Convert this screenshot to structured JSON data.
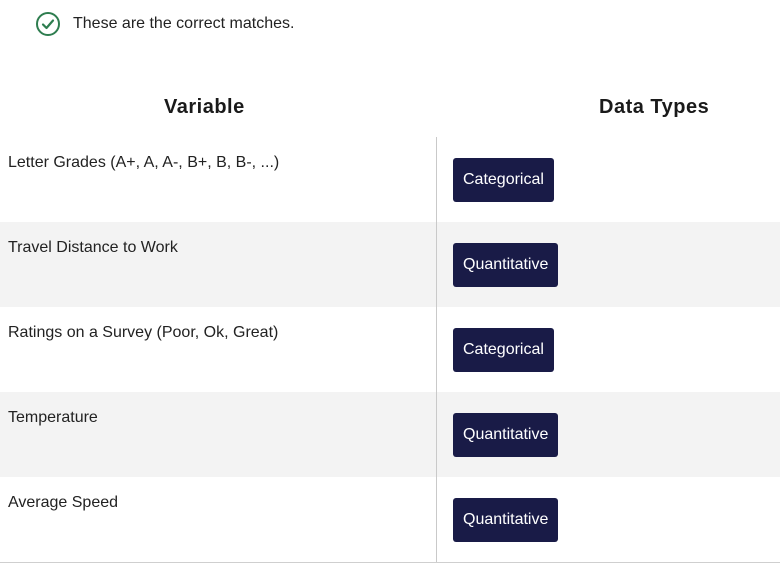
{
  "feedback": {
    "message": "These are the correct matches.",
    "icon": "check-circle-icon",
    "icon_color": "#2e7d4f"
  },
  "headers": {
    "variable": "Variable",
    "types": "Data Types"
  },
  "chip_color": "#191b47",
  "rows": [
    {
      "variable": "Letter Grades (A+, A, A-, B+, B, B-, ...)",
      "type": "Categorical"
    },
    {
      "variable": "Travel Distance to Work",
      "type": "Quantitative"
    },
    {
      "variable": "Ratings on a Survey (Poor, Ok, Great)",
      "type": "Categorical"
    },
    {
      "variable": "Temperature",
      "type": "Quantitative"
    },
    {
      "variable": "Average Speed",
      "type": "Quantitative"
    }
  ]
}
